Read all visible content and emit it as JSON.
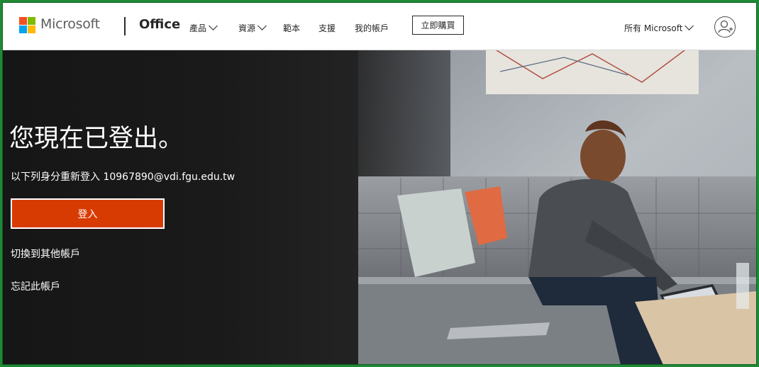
{
  "header": {
    "brand": "Microsoft",
    "product": "Office",
    "nav": [
      {
        "label": "產品",
        "dropdown": true
      },
      {
        "label": "資源",
        "dropdown": true
      },
      {
        "label": "範本",
        "dropdown": false
      },
      {
        "label": "支援",
        "dropdown": false
      },
      {
        "label": "我的帳戶",
        "dropdown": false
      }
    ],
    "buy_label": "立即購買",
    "all_microsoft": "所有 Microsoft"
  },
  "main": {
    "title": "您現在已登出。",
    "subtitle": "以下列身分重新登入 10967890@vdi.fgu.edu.tw",
    "signin_label": "登入",
    "switch_account": "切換到其他帳戶",
    "forget_account": "忘記此帳戶"
  },
  "colors": {
    "accent": "#d83b01",
    "frame": "#1e8a35",
    "logo_red": "#f25022",
    "logo_green": "#7fba00",
    "logo_blue": "#00a4ef",
    "logo_yellow": "#ffb900"
  }
}
